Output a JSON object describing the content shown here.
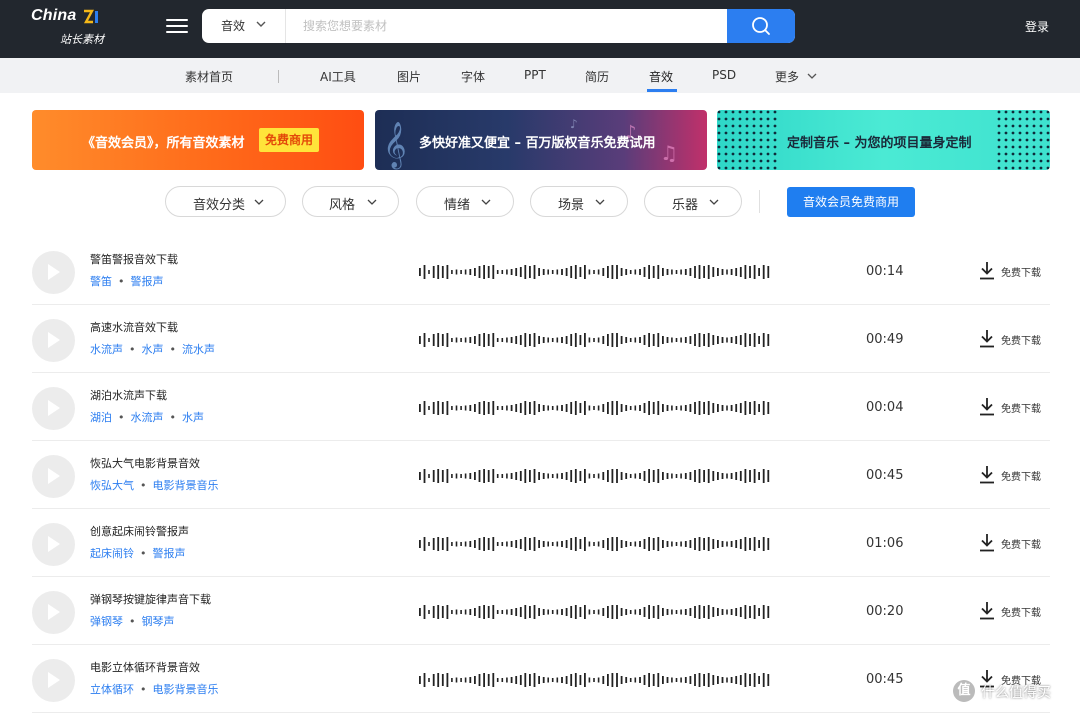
{
  "header": {
    "logo_text": "China",
    "logo_subtitle": "站长素材",
    "search_category": "音效",
    "search_placeholder": "搜索您想要素材",
    "login": "登录",
    "menu_icon": "hamburger-icon",
    "search_icon": "search-icon"
  },
  "nav": {
    "items": [
      {
        "label": "素材首页"
      },
      {
        "label": "AI工具"
      },
      {
        "label": "图片"
      },
      {
        "label": "字体"
      },
      {
        "label": "PPT"
      },
      {
        "label": "简历"
      },
      {
        "label": "音效"
      },
      {
        "label": "PSD"
      },
      {
        "label": "更多"
      }
    ],
    "active": "音效"
  },
  "banners": [
    {
      "text": "《音效会员》，所有音效素材",
      "badge": "免费商用"
    },
    {
      "text": "多快好准又便宜 – 百万版权音乐免费试用"
    },
    {
      "text": "定制音乐 – 为您的项目量身定制"
    }
  ],
  "filters": [
    {
      "label": "音效分类"
    },
    {
      "label": "风格"
    },
    {
      "label": "情绪"
    },
    {
      "label": "场景"
    },
    {
      "label": "乐器"
    }
  ],
  "vip_button": "音效会员免费商用",
  "download_label": "免费下载",
  "sounds": [
    {
      "title": "警笛警报音效下载",
      "tags": [
        "警笛",
        "警报声"
      ],
      "duration": "00:14"
    },
    {
      "title": "高速水流音效下载",
      "tags": [
        "水流声",
        "水声",
        "流水声"
      ],
      "duration": "00:49"
    },
    {
      "title": "湖泊水流声下载",
      "tags": [
        "湖泊",
        "水流声",
        "水声"
      ],
      "duration": "00:04"
    },
    {
      "title": "恢弘大气电影背景音效",
      "tags": [
        "恢弘大气",
        "电影背景音乐"
      ],
      "duration": "00:45"
    },
    {
      "title": "创意起床闹铃警报声",
      "tags": [
        "起床闹铃",
        "警报声"
      ],
      "duration": "01:06"
    },
    {
      "title": "弹钢琴按键旋律声音下载",
      "tags": [
        "弹钢琴",
        "钢琴声"
      ],
      "duration": "00:20"
    },
    {
      "title": "电影立体循环背景音效",
      "tags": [
        "立体循环",
        "电影背景音乐"
      ],
      "duration": "00:45"
    }
  ],
  "watermark": {
    "icon": "值",
    "text": "什么值得买"
  },
  "colors": {
    "accent": "#2c7ef0",
    "topbar": "#22272e",
    "tag": "#2c7ef0"
  }
}
